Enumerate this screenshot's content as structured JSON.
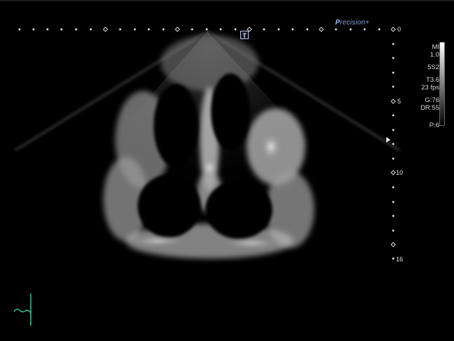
{
  "header": {
    "brand_letter": "P",
    "brand_rest": "recision+"
  },
  "transducer_marker": "T",
  "depth_scale": {
    "labels": [
      "0",
      "5",
      "10",
      "16"
    ]
  },
  "parameters": {
    "mi_label": "MI",
    "mi_value": "1.0",
    "probe": "5S2",
    "tis": "T3.6",
    "frame_rate": "23 fps",
    "gain": "G:76",
    "dynamic_range": "DR:55",
    "power": "P:6"
  },
  "colors": {
    "background": "#000000",
    "brand": "#7fa0d6",
    "ecg": "#2fd2a0"
  },
  "icons": {
    "ecg": "ecg-trace-icon",
    "focus": "focus-triangle-icon",
    "transducer": "transducer-orientation-icon"
  }
}
